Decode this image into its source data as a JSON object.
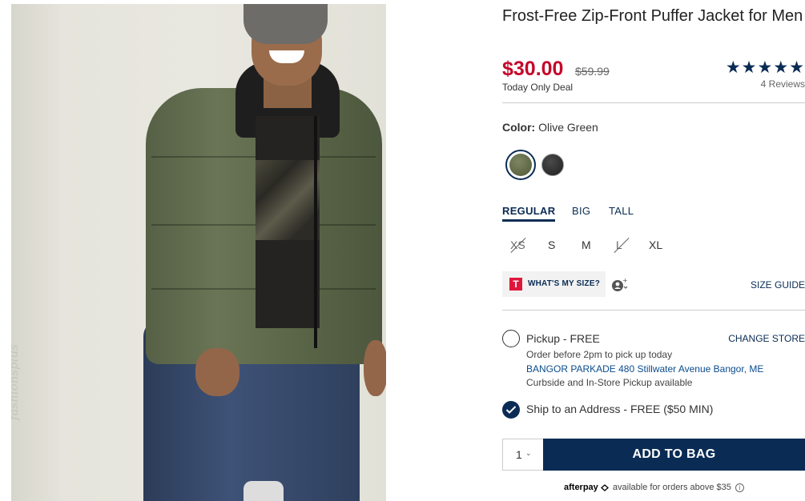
{
  "product": {
    "title": "Frost-Free Zip-Front Puffer Jacket for Men",
    "sale_price": "$30.00",
    "original_price": "$59.99",
    "deal_label": "Today Only Deal",
    "stars": "★★★★★",
    "reviews": "4 Reviews",
    "image_watermark": "fashionsplus"
  },
  "color": {
    "label": "Color:",
    "value": "Olive Green",
    "swatches": [
      {
        "name": "Olive Green",
        "hex": "#5c6746",
        "selected": true
      },
      {
        "name": "Black",
        "hex": "#2b2b2b",
        "selected": false
      }
    ]
  },
  "fit_tabs": [
    {
      "label": "REGULAR",
      "active": true
    },
    {
      "label": "BIG",
      "active": false
    },
    {
      "label": "TALL",
      "active": false
    }
  ],
  "sizes": [
    {
      "label": "XS",
      "available": false
    },
    {
      "label": "S",
      "available": true
    },
    {
      "label": "M",
      "available": true
    },
    {
      "label": "L",
      "available": false
    },
    {
      "label": "XL",
      "available": true
    }
  ],
  "fit_tool": {
    "logo": "T",
    "label": "WHAT'S MY SIZE?",
    "size_guide": "SIZE GUIDE"
  },
  "fulfillment": {
    "pickup": {
      "label": "Pickup - FREE",
      "change_store": "CHANGE STORE",
      "order_by": "Order before 2pm to pick up today",
      "store": "BANGOR PARKADE 480 Stillwater Avenue  Bangor, ME",
      "availability": "Curbside and In-Store Pickup available",
      "selected": false
    },
    "ship": {
      "label": "Ship to an Address - FREE ($50 MIN)",
      "selected": true
    }
  },
  "cart": {
    "quantity": "1",
    "add_label": "ADD TO BAG"
  },
  "afterpay": {
    "brand": "afterpay",
    "text": "available for orders above $35",
    "info": "i"
  },
  "colors": {
    "brand_navy": "#0a2c54",
    "sale_red": "#c4082a"
  }
}
